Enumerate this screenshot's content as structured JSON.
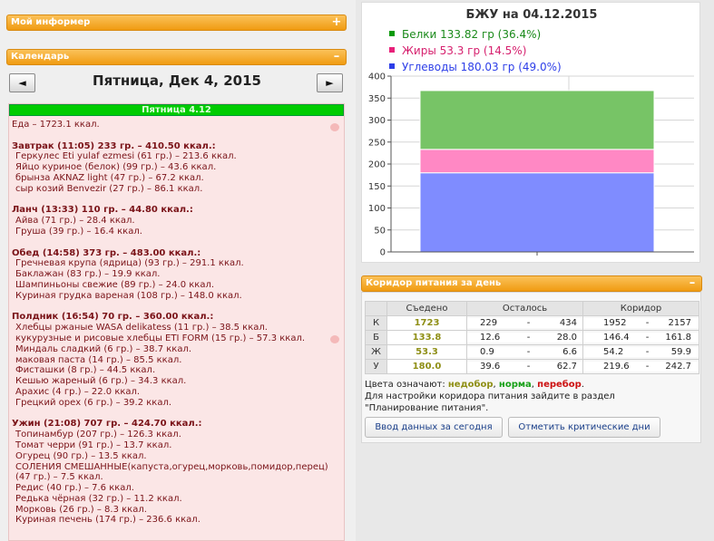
{
  "informer": {
    "title": "Мой информер",
    "toggle": "+"
  },
  "calendar": {
    "title": "Календарь",
    "toggle": "–",
    "prev": "◄",
    "next": "►",
    "date_title": "Пятница, Дек 4, 2015"
  },
  "day": {
    "header": "Пятница 4.12",
    "lines": [
      {
        "t": "Еда – 1723.1 ккал.",
        "k": "n"
      },
      {
        "t": "",
        "k": "sp"
      },
      {
        "t": "Завтрак (11:05) 233 гр. – 410.50 ккал.:",
        "k": "b"
      },
      {
        "t": "Геркулес Eti yulaf ezmesi (61 гр.) – 213.6 ккал.",
        "k": "i"
      },
      {
        "t": "Яйцо куриное (белок) (99 гр.) – 43.6 ккал.",
        "k": "i"
      },
      {
        "t": "брынза AKNAZ light (47 гр.) – 67.2 ккал.",
        "k": "i"
      },
      {
        "t": "сыр козий Benvezir (27 гр.) – 86.1 ккал.",
        "k": "i"
      },
      {
        "t": "",
        "k": "sp"
      },
      {
        "t": "Ланч (13:33) 110 гр. – 44.80 ккал.:",
        "k": "b"
      },
      {
        "t": "Айва (71 гр.) – 28.4 ккал.",
        "k": "i"
      },
      {
        "t": "Груша (39 гр.) – 16.4 ккал.",
        "k": "i"
      },
      {
        "t": "",
        "k": "sp"
      },
      {
        "t": "Обед (14:58) 373 гр. – 483.00 ккал.:",
        "k": "b"
      },
      {
        "t": "Гречневая крупа (ядрица) (93 гр.) – 291.1 ккал.",
        "k": "i"
      },
      {
        "t": "Баклажан (83 гр.) – 19.9 ккал.",
        "k": "i"
      },
      {
        "t": "Шампиньоны свежие (89 гр.) – 24.0 ккал.",
        "k": "i"
      },
      {
        "t": "Куриная грудка вареная (108 гр.) – 148.0 ккал.",
        "k": "i"
      },
      {
        "t": "",
        "k": "sp"
      },
      {
        "t": "Полдник (16:54) 70 гр. – 360.00 ккал.:",
        "k": "b"
      },
      {
        "t": "Хлебцы ржаные WASA delikatess (11 гр.) – 38.5 ккал.",
        "k": "i"
      },
      {
        "t": "кукурузные и рисовые хлебцы ETI FORM (15 гр.) – 57.3 ккал.",
        "k": "i"
      },
      {
        "t": "Миндаль сладкий (6 гр.) – 38.7 ккал.",
        "k": "i"
      },
      {
        "t": "маковая паста (14 гр.) – 85.5 ккал.",
        "k": "i"
      },
      {
        "t": "Фисташки (8 гр.) – 44.5 ккал.",
        "k": "i"
      },
      {
        "t": "Кешью жареный (6 гр.) – 34.3 ккал.",
        "k": "i"
      },
      {
        "t": "Арахис (4 гр.) – 22.0 ккал.",
        "k": "i"
      },
      {
        "t": "Грецкий орех (6 гр.) – 39.2 ккал.",
        "k": "i"
      },
      {
        "t": "",
        "k": "sp"
      },
      {
        "t": "Ужин (21:08) 707 гр. – 424.70 ккал.:",
        "k": "b"
      },
      {
        "t": "Топинамбур (207 гр.) – 126.3 ккал.",
        "k": "i"
      },
      {
        "t": "Томат черри (91 гр.) – 13.7 ккал.",
        "k": "i"
      },
      {
        "t": "Огурец (90 гр.) – 13.5 ккал.",
        "k": "i"
      },
      {
        "t": "СОЛЕНИЯ СМЕШАННЫЕ(капуста,огурец,морковь,помидор,перец) (47 гр.) – 7.5 ккал.",
        "k": "w"
      },
      {
        "t": "Редис (40 гр.) – 7.6 ккал.",
        "k": "i"
      },
      {
        "t": "Редька чёрная (32 гр.) – 11.2 ккал.",
        "k": "i"
      },
      {
        "t": "Морковь (26 гр.) – 8.3 ккал.",
        "k": "i"
      },
      {
        "t": "Куриная печень (174 гр.) – 236.6 ккал.",
        "k": "i"
      }
    ]
  },
  "chart_data": {
    "type": "bar",
    "title": "БЖУ на 04.12.2015",
    "ylim": [
      0,
      400
    ],
    "yticks": [
      "0",
      "50",
      "100",
      "150",
      "200",
      "250",
      "300",
      "350",
      "400"
    ],
    "stacked": true,
    "grid": true,
    "series": [
      {
        "name": "Белки 133.82 гр (36.4%)",
        "value": 133.82,
        "color": "#77c466",
        "legend_color": "#0a9a0a",
        "text_color": "#1a8a1a"
      },
      {
        "name": "Жиры 53.3 гр (14.5%)",
        "value": 53.3,
        "color": "#ff88c4",
        "legend_color": "#e8207a",
        "text_color": "#d6206e"
      },
      {
        "name": "Углеводы 180.03 гр (49.0%)",
        "value": 180.03,
        "color": "#7f8cff",
        "legend_color": "#2d3ee8",
        "text_color": "#2d3ee8"
      }
    ]
  },
  "corridor": {
    "title": "Коридор питания за день",
    "toggle": "–",
    "headers": [
      "Съедено",
      "Осталось",
      "Коридор"
    ],
    "rows": [
      {
        "label": "К",
        "eaten": "1723",
        "left_min": "229",
        "left_max": "434",
        "corr_min": "1952",
        "corr_max": "2157"
      },
      {
        "label": "Б",
        "eaten": "133.8",
        "left_min": "12.6",
        "left_max": "28.0",
        "corr_min": "146.4",
        "corr_max": "161.8"
      },
      {
        "label": "Ж",
        "eaten": "53.3",
        "left_min": "0.9",
        "left_max": "6.6",
        "corr_min": "54.2",
        "corr_max": "59.9"
      },
      {
        "label": "У",
        "eaten": "180.0",
        "left_min": "39.6",
        "left_max": "62.7",
        "corr_min": "219.6",
        "corr_max": "242.7"
      }
    ],
    "dash": "-",
    "colors_label": "Цвета означают:",
    "c_under": "недобор",
    "c_norm": "норма",
    "c_over": "перебор",
    "comma": ",",
    "period": ".",
    "colors": {
      "under": "#8f8f16",
      "norm": "#18a018",
      "over": "#cc1111"
    },
    "note1": "Для настройки коридора питания зайдите в раздел",
    "note2": "\"Планирование питания\".",
    "btn_enter": "Ввод данных за сегодня",
    "btn_critical": "Отметить критические дни"
  }
}
